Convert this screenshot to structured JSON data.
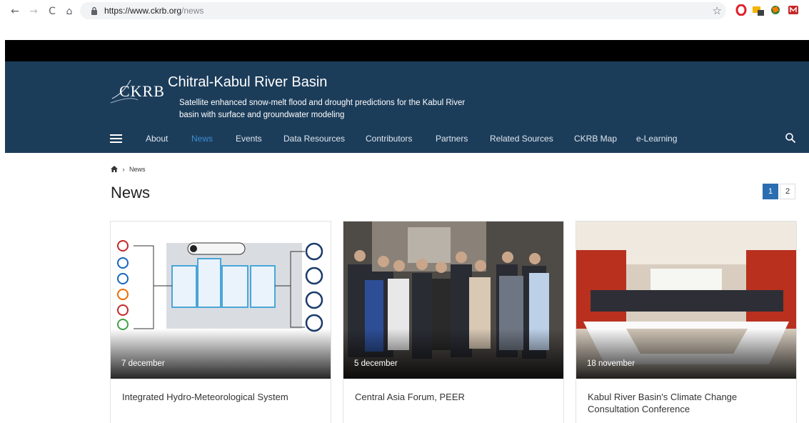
{
  "browser": {
    "url_host": "https://www.ckrb.org",
    "url_path": "/news"
  },
  "site": {
    "logo": "CKRB",
    "title": "Chitral-Kabul River Basin",
    "subtitle": "Satellite enhanced snow-melt flood and drought predictions for the Kabul River basin with surface and groundwater modeling"
  },
  "menu": {
    "items": [
      "About",
      "News",
      "Events",
      "Data Resources",
      "Contributors",
      "Partners",
      "Related Sources",
      "CKRB Map",
      "e-Learning"
    ],
    "active": "News"
  },
  "breadcrumb": {
    "current": "News"
  },
  "page": {
    "title": "News"
  },
  "pagination": {
    "current": "1",
    "next": "2"
  },
  "cards": [
    {
      "date": "7 december",
      "title": "Integrated Hydro-Meteorological System"
    },
    {
      "date": "5 december",
      "title": "Central Asia Forum, PEER"
    },
    {
      "date": "18 november",
      "title": "Kabul River Basin's Climate Change Consultation Conference"
    }
  ],
  "colors": {
    "header": "#1c3d5a",
    "accent": "#3d8bd0",
    "pager": "#2a6db1"
  }
}
